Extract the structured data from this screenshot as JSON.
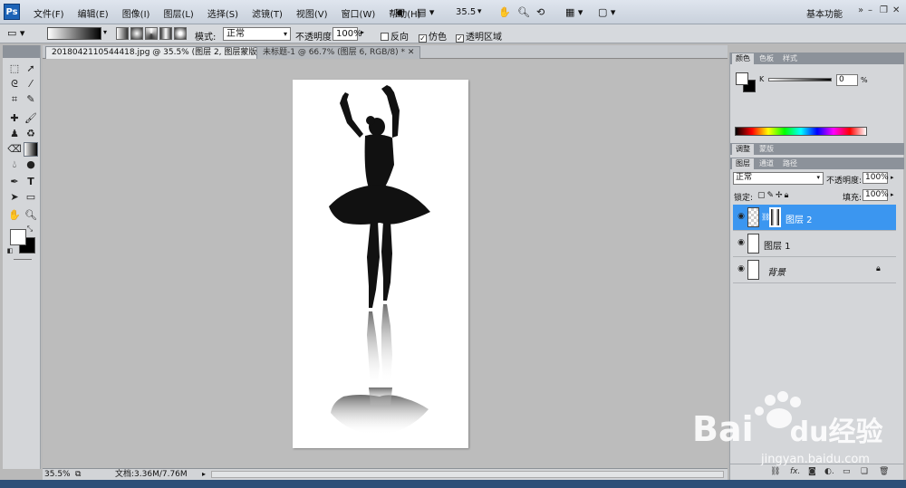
{
  "app": {
    "logo": "Ps",
    "workspace": "基本功能"
  },
  "menu": [
    "文件(F)",
    "编辑(E)",
    "图像(I)",
    "图层(L)",
    "选择(S)",
    "滤镜(T)",
    "视图(V)",
    "窗口(W)",
    "帮助(H)"
  ],
  "menubar_zoom": "35.5",
  "options": {
    "mode_label": "模式:",
    "mode_value": "正常",
    "opacity_label": "不透明度:",
    "opacity_value": "100%",
    "reverse_label": "反向",
    "dither_label": "仿色",
    "transparency_label": "透明区域",
    "reverse_checked": false,
    "dither_checked": true,
    "transparency_checked": true
  },
  "tabs": [
    {
      "label": "2018042110544418.jpg @ 35.5% (图层 2, 图层蒙版/8) *",
      "active": true
    },
    {
      "label": "未标题-1 @ 66.7% (图层 6, RGB/8) *",
      "active": false
    }
  ],
  "status": {
    "zoom": "35.5%",
    "doc_info": "文档:3.36M/7.76M"
  },
  "color_panel": {
    "tabs": [
      "颜色",
      "色板",
      "样式"
    ],
    "k_label": "K",
    "k_value": "0",
    "percent": "%"
  },
  "adjust_panel": {
    "tabs": [
      "调整",
      "蒙版"
    ]
  },
  "layers_panel": {
    "tabs": [
      "图层",
      "通道",
      "路径"
    ],
    "blend_mode": "正常",
    "opacity_label": "不透明度:",
    "opacity_value": "100%",
    "lock_label": "锁定:",
    "fill_label": "填充:",
    "fill_value": "100%",
    "layers": [
      {
        "name": "图层 2",
        "selected": true,
        "has_mask": true,
        "locked": false
      },
      {
        "name": "图层 1",
        "selected": false,
        "has_mask": false,
        "locked": false
      },
      {
        "name": "背景",
        "selected": false,
        "has_mask": false,
        "locked": true
      }
    ]
  },
  "watermark": {
    "brand": "Bai",
    "brand2": "du",
    "cn": "经验",
    "url": "jingyan.baidu.com"
  },
  "colors": {
    "selection": "#3b96f0",
    "canvas_bg": "#bcbcbc",
    "panel": "#d4d6d9"
  }
}
